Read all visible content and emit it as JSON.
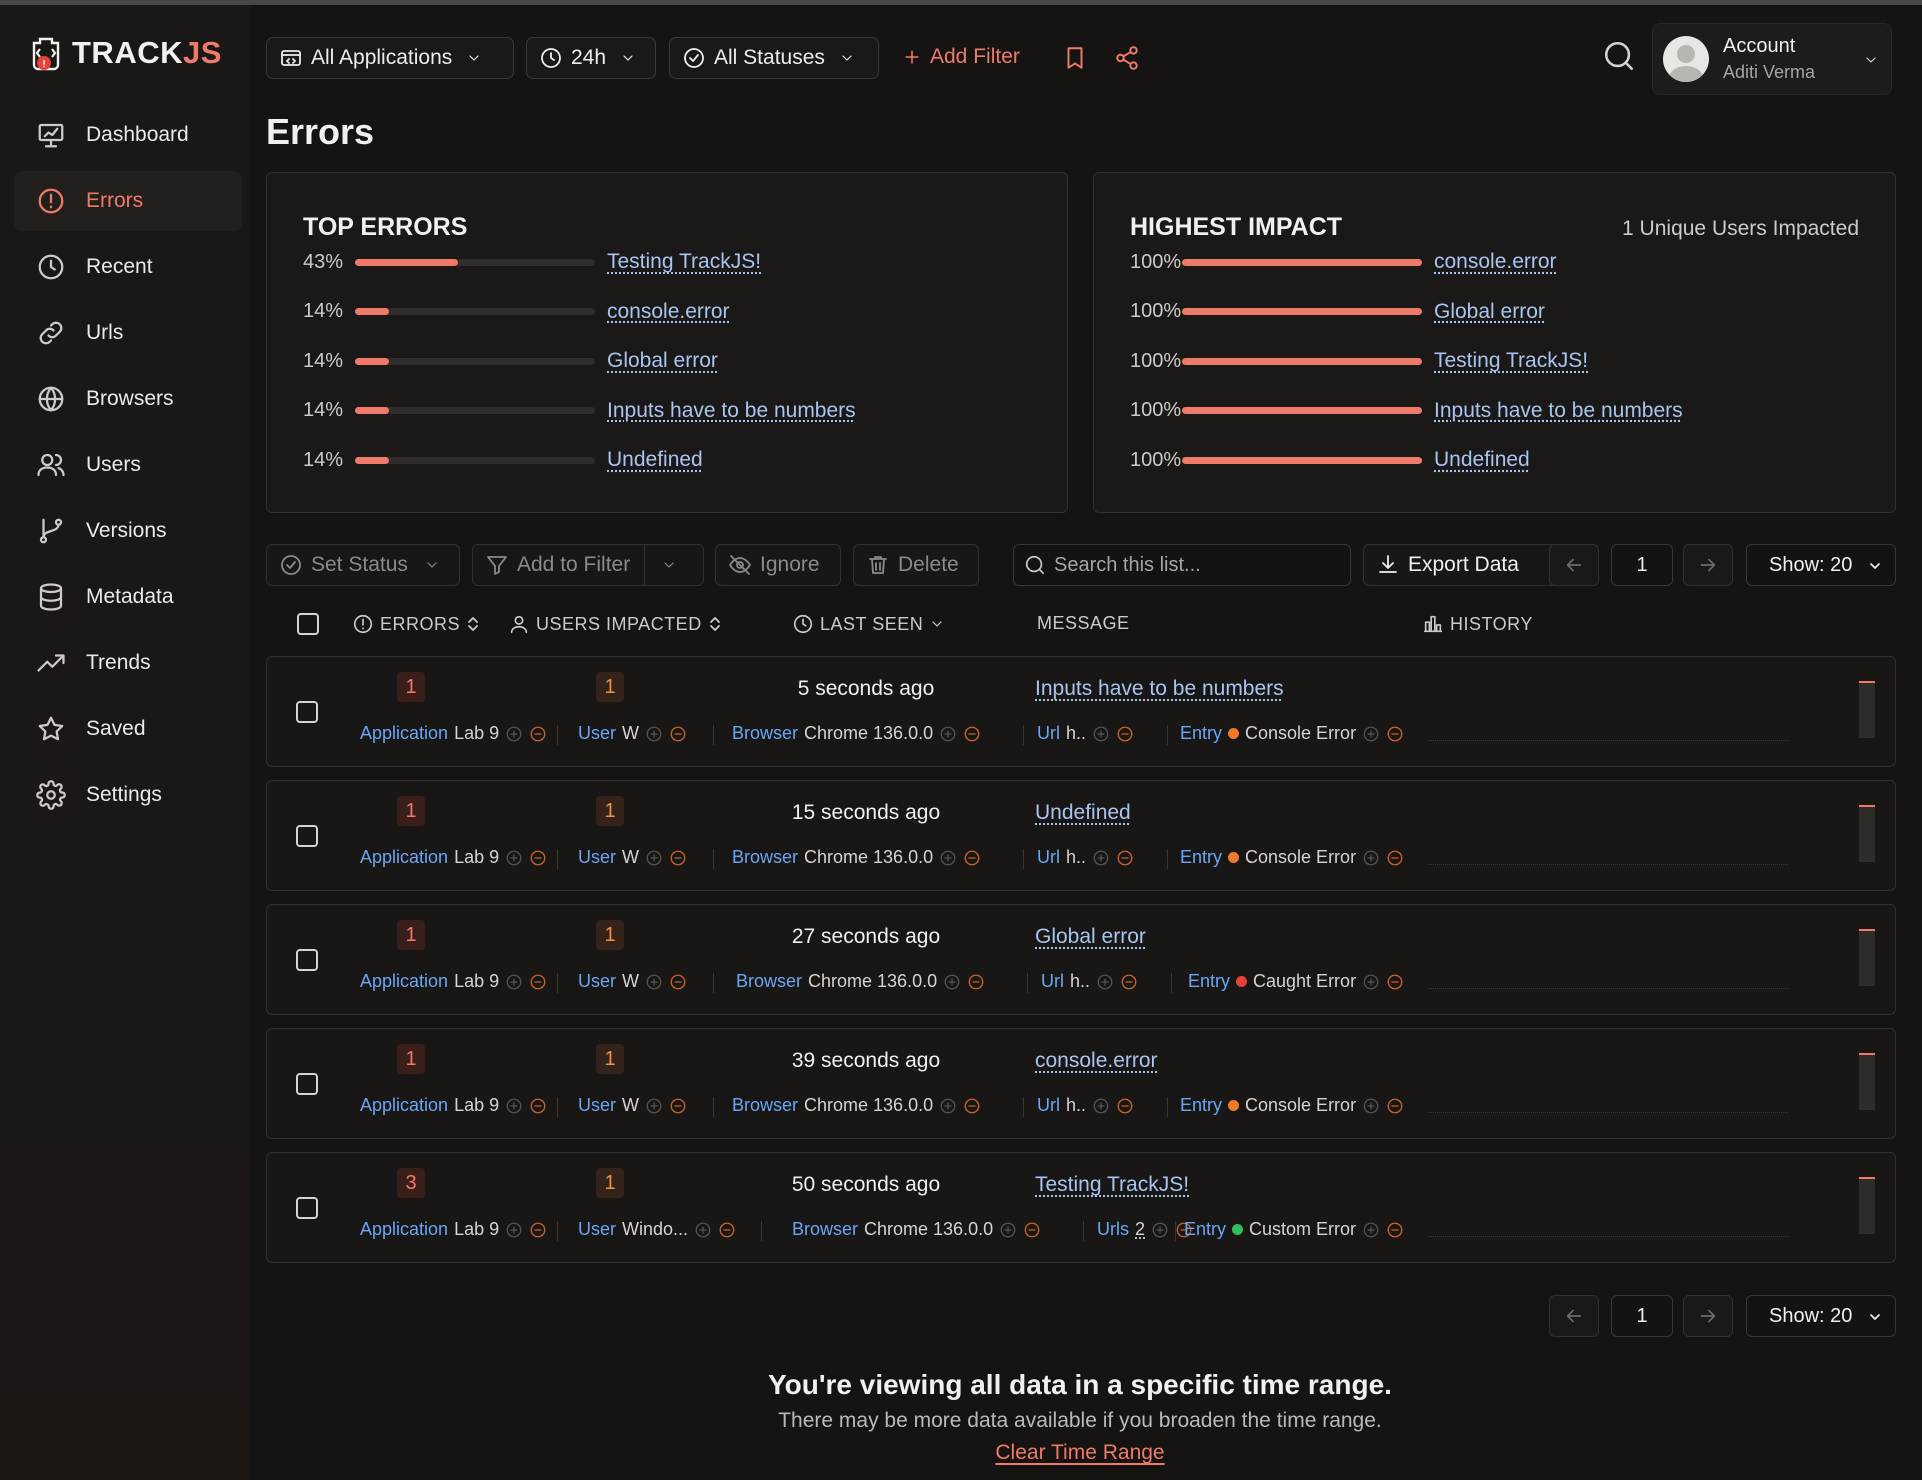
{
  "brand": {
    "name_main": "TRACK",
    "name_accent": "JS"
  },
  "sidebar": {
    "items": [
      {
        "label": "Dashboard",
        "icon": "dashboard-icon"
      },
      {
        "label": "Errors",
        "icon": "alert-circle-icon",
        "active": true
      },
      {
        "label": "Recent",
        "icon": "clock-icon"
      },
      {
        "label": "Urls",
        "icon": "link-icon"
      },
      {
        "label": "Browsers",
        "icon": "globe-icon"
      },
      {
        "label": "Users",
        "icon": "users-icon"
      },
      {
        "label": "Versions",
        "icon": "branch-icon"
      },
      {
        "label": "Metadata",
        "icon": "database-icon"
      },
      {
        "label": "Trends",
        "icon": "trend-icon"
      },
      {
        "label": "Saved",
        "icon": "star-icon"
      },
      {
        "label": "Settings",
        "icon": "gear-icon"
      }
    ]
  },
  "topbar": {
    "applications": "All Applications",
    "timerange": "24h",
    "statuses": "All Statuses",
    "add_filter": "Add Filter",
    "account_label": "Account",
    "account_name": "Aditi Verma"
  },
  "page_title": "Errors",
  "top_errors": {
    "title": "TOP ERRORS",
    "items": [
      {
        "pct": "43%",
        "value": 0.43,
        "label": "Testing TrackJS!"
      },
      {
        "pct": "14%",
        "value": 0.14,
        "label": "console.error"
      },
      {
        "pct": "14%",
        "value": 0.14,
        "label": "Global error"
      },
      {
        "pct": "14%",
        "value": 0.14,
        "label": "Inputs have to be numbers"
      },
      {
        "pct": "14%",
        "value": 0.14,
        "label": "Undefined"
      }
    ]
  },
  "highest_impact": {
    "title": "HIGHEST IMPACT",
    "note": "1 Unique Users Impacted",
    "items": [
      {
        "pct": "100%",
        "value": 1.0,
        "label": "console.error"
      },
      {
        "pct": "100%",
        "value": 1.0,
        "label": "Global error"
      },
      {
        "pct": "100%",
        "value": 1.0,
        "label": "Testing TrackJS!"
      },
      {
        "pct": "100%",
        "value": 1.0,
        "label": "Inputs have to be numbers"
      },
      {
        "pct": "100%",
        "value": 1.0,
        "label": "Undefined"
      }
    ]
  },
  "toolbar": {
    "set_status": "Set Status",
    "add_to_filter": "Add to Filter",
    "ignore": "Ignore",
    "delete": "Delete",
    "search_placeholder": "Search this list...",
    "export": "Export Data",
    "page": "1",
    "show": "Show: 20"
  },
  "table": {
    "headers": {
      "errors": "ERRORS",
      "users": "USERS IMPACTED",
      "last_seen": "LAST SEEN",
      "message": "MESSAGE",
      "history": "HISTORY"
    },
    "rows": [
      {
        "errors": "1",
        "users": "1",
        "last_seen": "5 seconds ago",
        "message": "Inputs have to be numbers",
        "app_key": "Application",
        "app": "Lab 9",
        "user_key": "User",
        "user": "W",
        "browser_key": "Browser",
        "browser": "Chrome 136.0.0",
        "url_key": "Url",
        "url": "h..",
        "entry_key": "Entry",
        "entry": "Console Error",
        "entry_color": "#f07a2a"
      },
      {
        "errors": "1",
        "users": "1",
        "last_seen": "15 seconds ago",
        "message": "Undefined",
        "app_key": "Application",
        "app": "Lab 9",
        "user_key": "User",
        "user": "W",
        "browser_key": "Browser",
        "browser": "Chrome 136.0.0",
        "url_key": "Url",
        "url": "h..",
        "entry_key": "Entry",
        "entry": "Console Error",
        "entry_color": "#f07a2a"
      },
      {
        "errors": "1",
        "users": "1",
        "last_seen": "27 seconds ago",
        "message": "Global error",
        "app_key": "Application",
        "app": "Lab 9",
        "user_key": "User",
        "user": "W",
        "browser_key": "Browser",
        "browser": "Chrome 136.0.0",
        "url_key": "Url",
        "url": "h..",
        "entry_key": "Entry",
        "entry": "Caught Error",
        "entry_color": "#e8413a"
      },
      {
        "errors": "1",
        "users": "1",
        "last_seen": "39 seconds ago",
        "message": "console.error",
        "app_key": "Application",
        "app": "Lab 9",
        "user_key": "User",
        "user": "W",
        "browser_key": "Browser",
        "browser": "Chrome 136.0.0",
        "url_key": "Url",
        "url": "h..",
        "entry_key": "Entry",
        "entry": "Console Error",
        "entry_color": "#f07a2a"
      },
      {
        "errors": "3",
        "users": "1",
        "last_seen": "50 seconds ago",
        "message": "Testing TrackJS!",
        "app_key": "Application",
        "app": "Lab 9",
        "user_key": "User",
        "user": "Windo...",
        "browser_key": "Browser",
        "browser": "Chrome 136.0.0",
        "url_key": "Urls",
        "url": "2",
        "entry_key": "Entry",
        "entry": "Custom Error",
        "entry_color": "#2fbf5a"
      }
    ]
  },
  "footer": {
    "title": "You're viewing all data in a specific time range.",
    "subtitle": "There may be more data available if you broaden the time range.",
    "link": "Clear Time Range"
  }
}
